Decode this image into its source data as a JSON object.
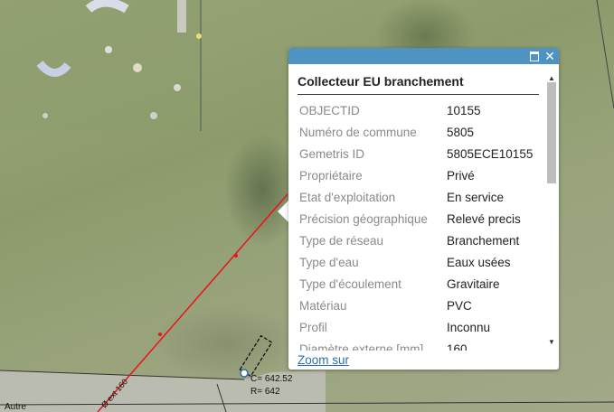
{
  "popup": {
    "title": "Collecteur EU branchement",
    "zoom_link": "Zoom sur",
    "controls": {
      "maximize_icon": "maximize-icon",
      "close_icon": "close-icon",
      "close_label": "✕"
    },
    "attributes": [
      {
        "key": "OBJECTID",
        "value": "10155"
      },
      {
        "key": "Numéro de commune",
        "value": "5805"
      },
      {
        "key": "Gemetris ID",
        "value": "5805ECE10155"
      },
      {
        "key": "Propriétaire",
        "value": "Privé"
      },
      {
        "key": "Etat d'exploitation",
        "value": "En service"
      },
      {
        "key": "Précision géographique",
        "value": "Relevé precis"
      },
      {
        "key": "Type de réseau",
        "value": "Branchement"
      },
      {
        "key": "Type d'eau",
        "value": "Eaux usées"
      },
      {
        "key": "Type d'écoulement",
        "value": "Gravitaire"
      },
      {
        "key": "Matériau",
        "value": "PVC"
      },
      {
        "key": "Profil",
        "value": "Inconnu"
      },
      {
        "key": "Diamètre externe [mm]",
        "value": "160"
      }
    ]
  },
  "map": {
    "pipe_label": "Ø ext 160",
    "manhole_label_c": "C= 642.52",
    "manhole_label_r": "R= 642",
    "road_label": "Autre",
    "pipe_color": "#e8151c",
    "accent_color": "#4f93c2"
  }
}
